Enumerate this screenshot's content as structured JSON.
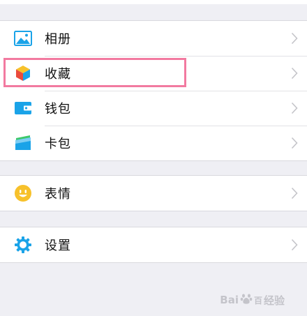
{
  "menu": {
    "group1": [
      {
        "label": "相册",
        "icon": "photo-album-icon"
      },
      {
        "label": "收藏",
        "icon": "favorites-cube-icon"
      },
      {
        "label": "钱包",
        "icon": "wallet-icon"
      },
      {
        "label": "卡包",
        "icon": "card-package-icon"
      }
    ],
    "group2": [
      {
        "label": "表情",
        "icon": "emoji-smile-icon"
      }
    ],
    "group3": [
      {
        "label": "设置",
        "icon": "settings-gear-icon"
      }
    ]
  },
  "colors": {
    "background": "#efeff4",
    "highlight": "#f27aa0",
    "icon_blue": "#1aa3e8",
    "emoji_yellow": "#f7c12b"
  },
  "watermark": {
    "text_brand": "Bai",
    "text_mid": "百",
    "text_cn": "经验"
  }
}
